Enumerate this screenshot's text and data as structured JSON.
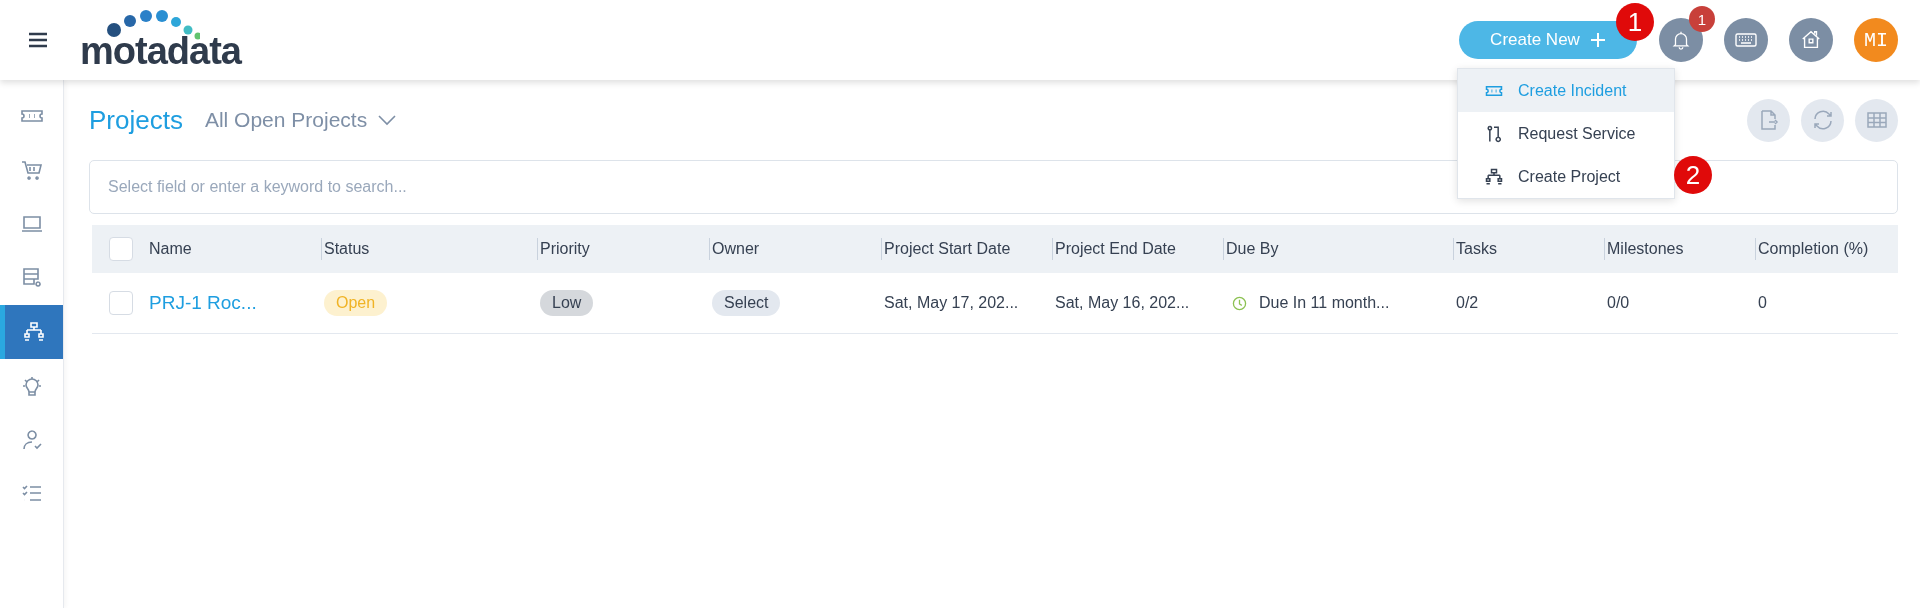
{
  "header": {
    "logo": "motadata",
    "create_button": "Create New",
    "notification_count": "1",
    "avatar": "MI"
  },
  "create_menu": [
    {
      "label": "Create Incident",
      "selected": true
    },
    {
      "label": "Request Service",
      "selected": false
    },
    {
      "label": "Create Project",
      "selected": false
    }
  ],
  "callouts": [
    "1",
    "2"
  ],
  "sidebar": {
    "items": [
      {
        "selected": false
      },
      {
        "selected": false
      },
      {
        "selected": false
      },
      {
        "selected": false
      },
      {
        "selected": true
      },
      {
        "selected": false
      },
      {
        "selected": false
      },
      {
        "selected": false
      }
    ]
  },
  "page": {
    "title": "Projects",
    "view": "All Open Projects",
    "search": {
      "placeholder": "Select field or enter a keyword to search..."
    }
  },
  "table": {
    "select_all_checked": false,
    "columns": [
      "Name",
      "Status",
      "Priority",
      "Owner",
      "Project Start Date",
      "Project End Date",
      "Due By",
      "Tasks",
      "Milestones",
      "Completion (%)"
    ],
    "rows": [
      {
        "checked": false,
        "cells": [
          {
            "kind": "link",
            "text": "PRJ-1 Roc..."
          },
          {
            "kind": "status",
            "text": "Open"
          },
          {
            "kind": "priority",
            "text": "Low"
          },
          {
            "kind": "owner",
            "text": "Select"
          },
          {
            "kind": "text",
            "text": "Sat, May 17, 202..."
          },
          {
            "kind": "text",
            "text": "Sat, May 16, 202..."
          },
          {
            "kind": "due",
            "text": "Due In 11 month..."
          },
          {
            "kind": "text",
            "text": "0/2"
          },
          {
            "kind": "text",
            "text": "0/0"
          },
          {
            "kind": "text",
            "text": "0"
          }
        ]
      }
    ]
  }
}
